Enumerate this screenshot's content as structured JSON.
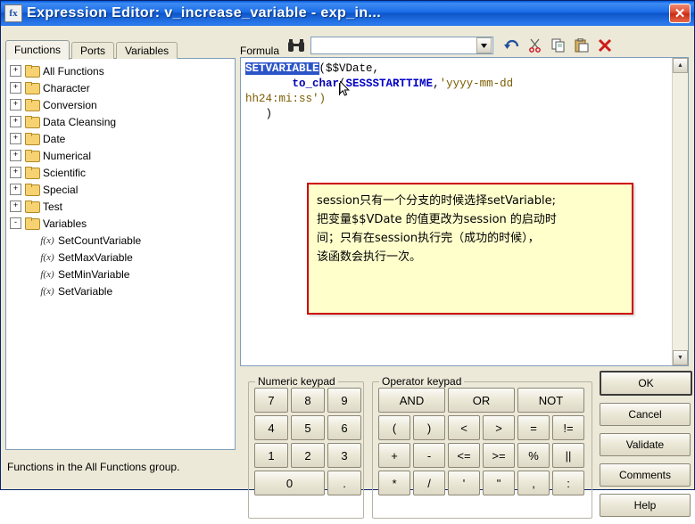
{
  "window": {
    "title": "Expression Editor: v_increase_variable - exp_in...",
    "icon": "fx-icon",
    "close_label": "✕"
  },
  "tabs": [
    {
      "label": "Functions",
      "active": true
    },
    {
      "label": "Ports",
      "active": false
    },
    {
      "label": "Variables",
      "active": false
    }
  ],
  "tree": {
    "groups": [
      {
        "label": "All Functions",
        "expander": "+"
      },
      {
        "label": "Character",
        "expander": "+"
      },
      {
        "label": "Conversion",
        "expander": "+"
      },
      {
        "label": "Data Cleansing",
        "expander": "+"
      },
      {
        "label": "Date",
        "expander": "+"
      },
      {
        "label": "Numerical",
        "expander": "+"
      },
      {
        "label": "Scientific",
        "expander": "+"
      },
      {
        "label": "Special",
        "expander": "+"
      },
      {
        "label": "Test",
        "expander": "+"
      },
      {
        "label": "Variables",
        "expander": "-"
      }
    ],
    "variables_children": [
      {
        "label": "SetCountVariable"
      },
      {
        "label": "SetMaxVariable"
      },
      {
        "label": "SetMinVariable"
      },
      {
        "label": "SetVariable"
      }
    ],
    "fx_glyph": "f(x)"
  },
  "status_hint": "Functions in the All Functions group.",
  "formula": {
    "label": "Formula",
    "find_icon": "binoculars-icon",
    "combo_value": "",
    "combo_placeholder": "",
    "dropdown_glyph": "▼",
    "toolbar": [
      {
        "name": "undo-button",
        "glyph": "↶"
      },
      {
        "name": "cut-button",
        "glyph": "✂"
      },
      {
        "name": "copy-button",
        "glyph": "⧉"
      },
      {
        "name": "paste-button",
        "glyph": "▤"
      },
      {
        "name": "delete-button",
        "glyph": "✕"
      }
    ]
  },
  "editor": {
    "selected_token": "SETVARIABLE",
    "line1_rest": "($$VDate,",
    "line2_fn": "to_char",
    "line2_open": "(",
    "line2_arg": "SESSSTARTTIME",
    "line2_comma": ",",
    "line2_str": "'yyyy-mm-dd",
    "line3_str": "hh24:mi:ss')",
    "line4": ")",
    "scroll_up": "▲",
    "scroll_down": "▼"
  },
  "tooltip": {
    "line1": "session只有一个分支的时候选择setVariable;",
    "line2": "把变量$$VDate 的值更改为session 的启动时",
    "line3": "间；只有在session执行完（成功的时候），",
    "line4": "该函数会执行一次。"
  },
  "numeric_keypad": {
    "title": "Numeric keypad",
    "keys": [
      "7",
      "8",
      "9",
      "4",
      "5",
      "6",
      "1",
      "2",
      "3"
    ],
    "wide_key": "0",
    "dot_key": "."
  },
  "operator_keypad": {
    "title": "Operator keypad",
    "row1": [
      "AND",
      "OR",
      "NOT"
    ],
    "rows": [
      [
        "(",
        ")",
        "<",
        ">",
        "=",
        "!="
      ],
      [
        "+",
        "-",
        "<=",
        ">=",
        "%",
        "||"
      ],
      [
        "*",
        "/",
        "'",
        "\"",
        ",",
        ":"
      ]
    ]
  },
  "dialog_buttons": [
    {
      "label": "OK",
      "default": true
    },
    {
      "label": "Cancel",
      "default": false
    },
    {
      "label": "Validate",
      "default": false
    },
    {
      "label": "Comments",
      "default": false
    },
    {
      "label": "Help",
      "default": false
    }
  ]
}
